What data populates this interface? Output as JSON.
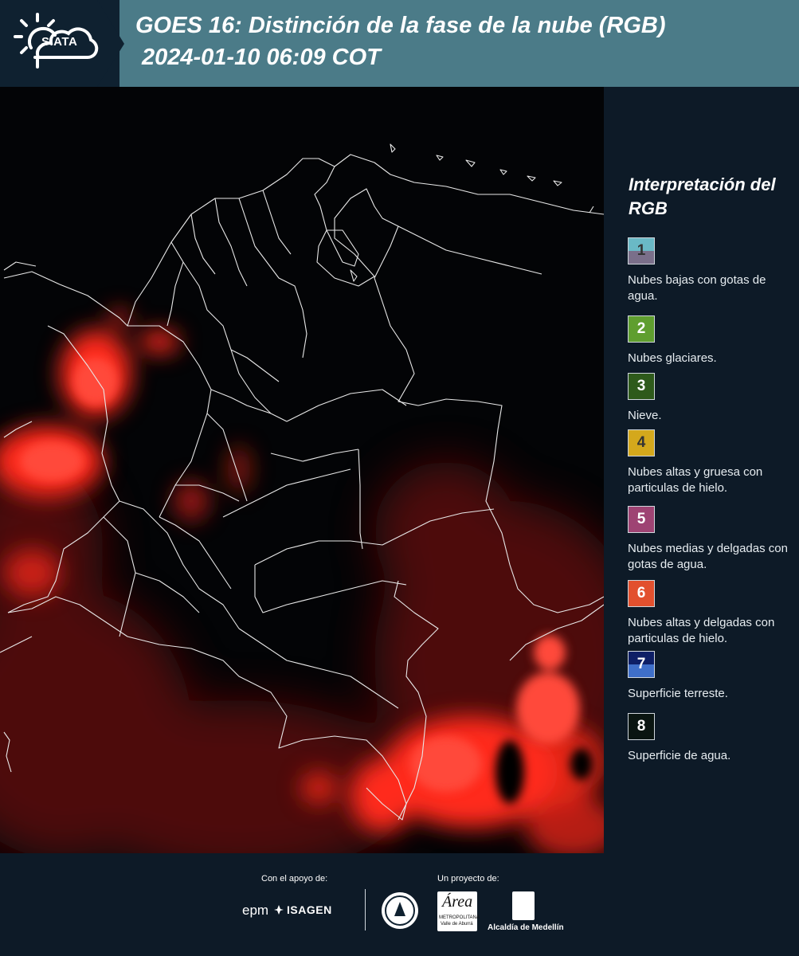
{
  "header": {
    "logo_text": "SIATA",
    "title": "GOES 16: Distinción de la fase de la nube (RGB)",
    "timestamp": "2024-01-10 06:09 COT"
  },
  "legend": {
    "title": "Interpretación del RGB",
    "items": [
      {
        "number": "1",
        "label": "Nubes bajas con gotas de agua.",
        "color_top": "#6ab9c6",
        "color_bottom": "#7a6f8a",
        "text_color": "#333333"
      },
      {
        "number": "2",
        "label": "Nubes glaciares.",
        "color_top": "#5f9e2f",
        "color_bottom": "#5f9e2f",
        "text_color": "#ffffff"
      },
      {
        "number": "3",
        "label": "Nieve.",
        "color_top": "#2e5a1b",
        "color_bottom": "#2e5a1b",
        "text_color": "#ffffff"
      },
      {
        "number": "4",
        "label": "Nubes altas y gruesa con particulas de hielo.",
        "color_top": "#d4a81c",
        "color_bottom": "#d4a81c",
        "text_color": "#333333"
      },
      {
        "number": "5",
        "label": "Nubes medias y delgadas con gotas de agua.",
        "color_top": "#9e4373",
        "color_bottom": "#9e4373",
        "text_color": "#ffffff"
      },
      {
        "number": "6",
        "label": "Nubes altas y delgadas con particulas de hielo.",
        "color_top": "#e2502e",
        "color_bottom": "#e2502e",
        "text_color": "#ffffff"
      },
      {
        "number": "7",
        "label": "Superficie terreste.",
        "color_top": "#0e1f66",
        "color_bottom": "#3f6fc9",
        "text_color": "#ffffff"
      },
      {
        "number": "8",
        "label": "Superficie de agua.",
        "color_top": "#0a1511",
        "color_bottom": "#0a1511",
        "text_color": "#ffffff"
      }
    ]
  },
  "footer": {
    "support_caption": "Con el apoyo de:",
    "project_caption": "Un proyecto de:",
    "epm": "epm",
    "isagen": "ISAGEN",
    "area_name": "Área",
    "area_sub": "METROPOLITANA",
    "area_sub2": "Valle de Aburrá",
    "alcaldia": "Alcaldía de Medellín"
  },
  "colors": {
    "header_bg": "#4b7b88",
    "logo_bg": "#0f2130",
    "panel_bg": "#0d1a27",
    "cloud_red": "#ff2a1a"
  }
}
